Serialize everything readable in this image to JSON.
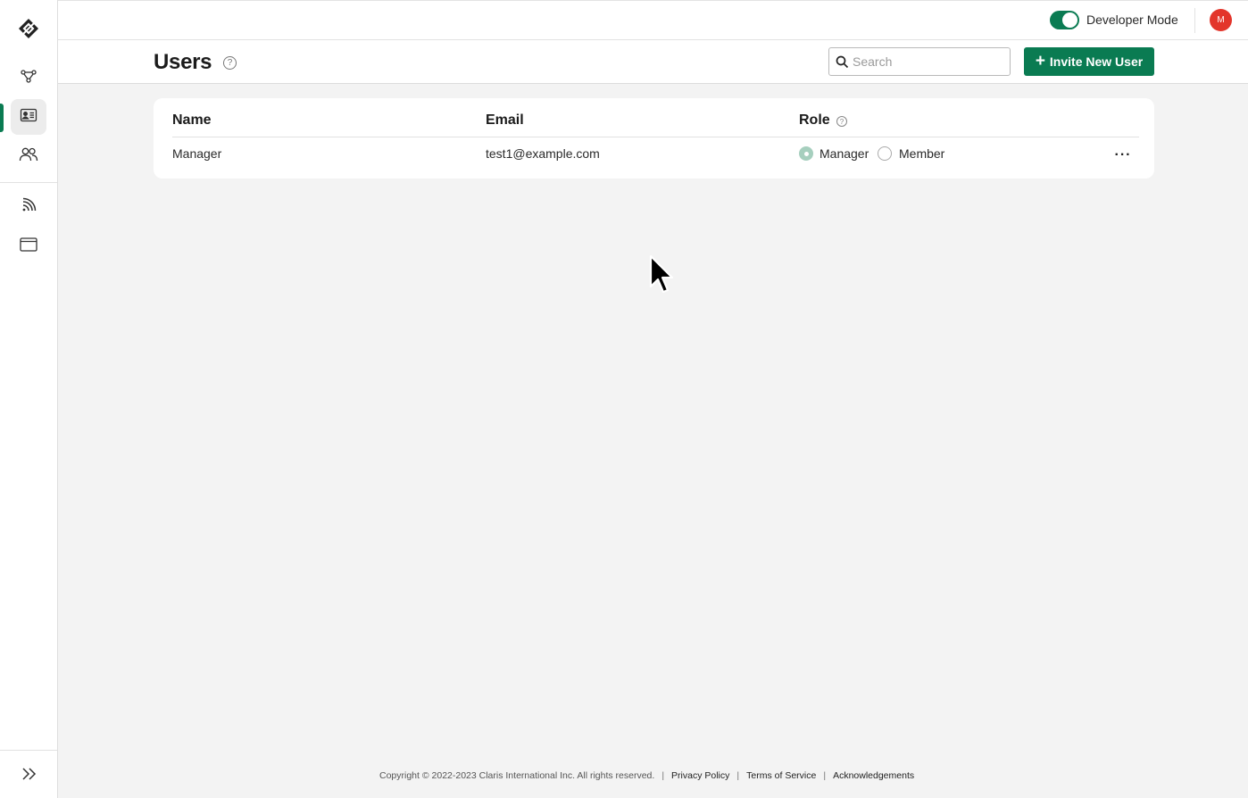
{
  "sidebar": {
    "logo": "claris-logo-icon",
    "items": [
      {
        "icon": "integrations-icon"
      },
      {
        "icon": "user-card-icon",
        "active": true
      },
      {
        "icon": "groups-icon"
      },
      {
        "icon": "feed-icon"
      },
      {
        "icon": "window-icon"
      }
    ],
    "expand_icon": "double-chevron-right-icon",
    "accent_color": "#0a7b52"
  },
  "topbar": {
    "developer_mode_label": "Developer Mode",
    "developer_mode_on": true,
    "avatar_initial": "M",
    "avatar_color": "#e3352b"
  },
  "page": {
    "title": "Users",
    "search_placeholder": "Search",
    "invite_plus": "+",
    "invite_label": "Invite New User"
  },
  "table": {
    "columns": [
      "Name",
      "Email",
      "Role"
    ],
    "role_help": "?",
    "rows": [
      {
        "name": "Manager",
        "email": "test1@example.com",
        "role_options": [
          "Manager",
          "Member"
        ],
        "selected_role": "Manager",
        "more": "···"
      }
    ]
  },
  "footer": {
    "copyright": "Copyright © 2022-2023 Claris International Inc. All rights reserved.",
    "separator": "|",
    "links": [
      "Privacy Policy",
      "Terms of Service",
      "Acknowledgements"
    ]
  }
}
